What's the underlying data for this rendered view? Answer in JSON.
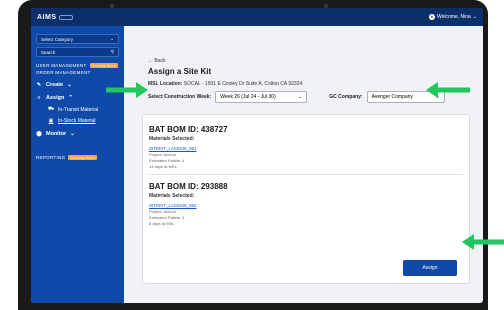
{
  "app": {
    "logo": "AIMS",
    "welcome": "Welcome, Nina"
  },
  "sidebar": {
    "select_category": "Select Category",
    "search_placeholder": "Search",
    "user_management": "USER MANAGEMENT",
    "coming_soon_1": "Coming Soon",
    "order_management": "ORDER MANAGEMENT",
    "create": "Create",
    "assign": "Assign",
    "in_transit": "In-Transit Material",
    "in_stock": "In-Stock Material",
    "monitor": "Monitor",
    "reporting": "REPORTING",
    "coming_soon_2": "Coming Soon"
  },
  "main": {
    "back": "Back",
    "title": "Assign a Site Kit",
    "msl_label": "MSL Location:",
    "msl_value": "SOCAL - 1501 E Cooley Dr Suite A, Colton CA 92324",
    "week_label": "Select Construction Week:",
    "week_value": "Week 26 (Jul 24 - Jul 30)",
    "gc_label": "GC Company:",
    "gc_value": "Avenger Company"
  },
  "boms": [
    {
      "title": "BAT BOM ID: 438727",
      "materials_label": "Materials Selected:",
      "kit": "SITEKIT_LA02346_351",
      "project": "Project: Anchor",
      "pallets": "Estimated Pallets: 4",
      "days": "14 days at MSL"
    },
    {
      "title": "BAT BOM ID: 293888",
      "materials_label": "Materials Selected:",
      "kit": "SITEKIT_LA02346_352",
      "project": "Project: Anchor",
      "pallets": "Estimated Pallets: 3",
      "days": "8 days at MSL"
    }
  ],
  "assign_button": "Assign",
  "colors": {
    "primary": "#0f4aa8",
    "topbar": "#0b2f6b",
    "badge": "#f3a53b",
    "arrow": "#22c55e"
  },
  "icons": [
    "user-icon",
    "search-icon",
    "chevron-down-icon",
    "pencil-icon",
    "list-icon",
    "truck-icon",
    "box-icon",
    "location-pin-icon",
    "arrow-left-icon"
  ]
}
